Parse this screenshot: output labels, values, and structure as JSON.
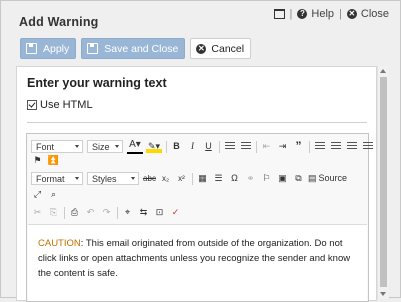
{
  "dialog": {
    "title": "Add Warning",
    "help_label": "Help",
    "close_label": "Close",
    "separator": "|"
  },
  "toolbar": {
    "apply_label": "Apply",
    "save_close_label": "Save and Close",
    "cancel_label": "Cancel"
  },
  "form": {
    "heading": "Enter your warning text",
    "use_html_label": "Use HTML",
    "use_html_checked": true
  },
  "editor": {
    "font_label": "Font",
    "size_label": "Size",
    "format_label": "Format",
    "styles_label": "Styles",
    "source_label": "Source",
    "bold": "B",
    "italic": "I",
    "underline": "U",
    "content_prefix": "CAUTION",
    "content_text": ": This email originated from outside of the organization. Do not click links or open attachments unless you recognize the sender and know the content is safe."
  },
  "colors": {
    "primary_button": "#99b6d6",
    "caution": "#c07000"
  }
}
